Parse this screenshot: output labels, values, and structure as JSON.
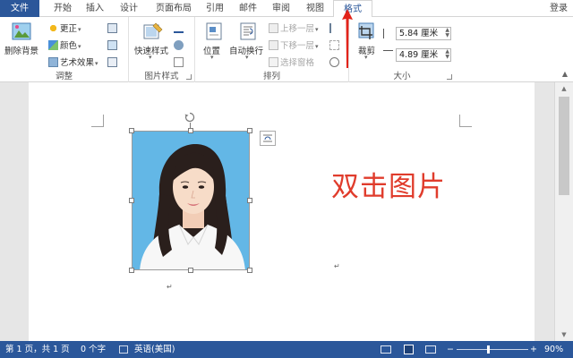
{
  "tabs": {
    "file": "文件",
    "home": "开始",
    "insert": "插入",
    "design": "设计",
    "layout": "页面布局",
    "references": "引用",
    "mailings": "邮件",
    "review": "审阅",
    "view": "视图",
    "format": "格式",
    "login": "登录"
  },
  "ribbon": {
    "adjust": {
      "label": "调整",
      "remove_bg": "删除背景",
      "corrections": "更正",
      "color": "颜色",
      "artistic": "艺术效果"
    },
    "picture_styles": {
      "label": "图片样式",
      "quick_styles": "快速样式"
    },
    "arrange": {
      "label": "排列",
      "position": "位置",
      "wrap": "自动换行",
      "bring_forward": "上移一层",
      "send_backward": "下移一层",
      "selection_pane": "选择窗格"
    },
    "size": {
      "label": "大小",
      "crop": "裁剪",
      "height": "5.84 厘米",
      "width": "4.89 厘米"
    }
  },
  "document": {
    "annotation": "双击图片",
    "para_mark": "↵"
  },
  "status": {
    "page": "第 1 页，共 1 页",
    "words": "0 个字",
    "language": "英语(美国)",
    "zoom": "90%"
  },
  "colors": {
    "accent": "#2b579a",
    "annotation": "#e03c2c",
    "arrow": "#e2231a",
    "photo_bg": "#63b7e6"
  }
}
